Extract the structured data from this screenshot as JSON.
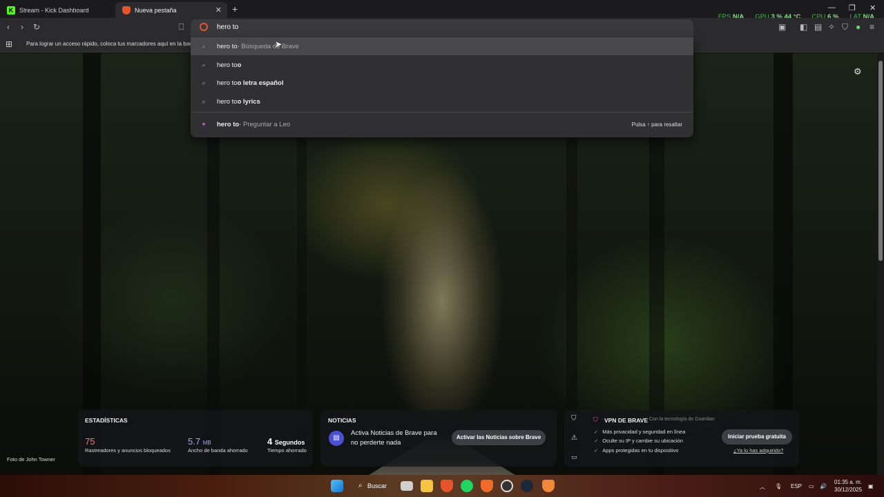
{
  "tabs": [
    {
      "title": "Stream - Kick Dashboard",
      "active": false,
      "icon": "kick-icon"
    },
    {
      "title": "Nueva pestaña",
      "active": true,
      "icon": "brave-icon"
    }
  ],
  "hud": {
    "fps_label": "FPS",
    "fps_value": "N/A",
    "gpu_label": "GPU",
    "gpu_value": "3 %",
    "gpu_temp": "44 °C",
    "cpu_label": "CPU",
    "cpu_value": "6 %",
    "lat_label": "LAT",
    "lat_value": "N/A"
  },
  "omnibox": {
    "value": "hero to"
  },
  "bookmarks_bar": {
    "hint": "Para lograr un acceso rápido, coloca tus marcadores aquí en la barra"
  },
  "suggestions": [
    {
      "query": "hero to",
      "suffix": " - Búsqueda de Brave",
      "bold": "",
      "icon": "search-icon",
      "highlighted": true
    },
    {
      "query": "hero to",
      "suffix": "",
      "bold": "o",
      "icon": "search-icon",
      "highlighted": false
    },
    {
      "query": "hero to",
      "suffix": "",
      "bold": "o letra español",
      "icon": "search-icon",
      "highlighted": false
    },
    {
      "query": "hero to",
      "suffix": "",
      "bold": "o lyrics",
      "icon": "search-icon",
      "highlighted": false
    }
  ],
  "leo_suggestion": {
    "query": "hero to",
    "suffix": " - Preguntar a Leo",
    "hint": "Pulsa ↑ para resaltar"
  },
  "stats": {
    "title": "ESTADÍSTICAS",
    "trackers_value": "75",
    "trackers_label": "Rastreadores y anuncios bloqueados",
    "bandwidth_value": "5.7",
    "bandwidth_unit": "MB",
    "bandwidth_label": "Ancho de banda ahorrado",
    "time_value": "4",
    "time_unit": "Segundos",
    "time_label": "Tiempo ahorrado"
  },
  "news": {
    "title": "NOTICIAS",
    "text": "Activa Noticias de Brave para no perderte nada",
    "button": "Activar las Noticias sobre Brave"
  },
  "vpn": {
    "title": "VPN DE BRAVE",
    "powered": "Con la tecnología de Guardian",
    "features": [
      "Más privacidad y seguridad en línea",
      "Oculte su IP y cambie su ubicación",
      "Apps protegidas en tu dispositivo"
    ],
    "button": "Iniciar prueba gratuita",
    "link": "¿Ya lo has adquirido?"
  },
  "photo_credit": "Foto de John Towner",
  "taskbar": {
    "search_label": "Buscar",
    "lang": "ESP",
    "time": "01:35 a. m.",
    "date": "30/12/2025"
  },
  "colors": {
    "stat_trackers": "#ff7b72",
    "stat_bandwidth": "#a8a6ff",
    "hud_green": "#3fb84a",
    "brave_orange": "#e8542a"
  }
}
